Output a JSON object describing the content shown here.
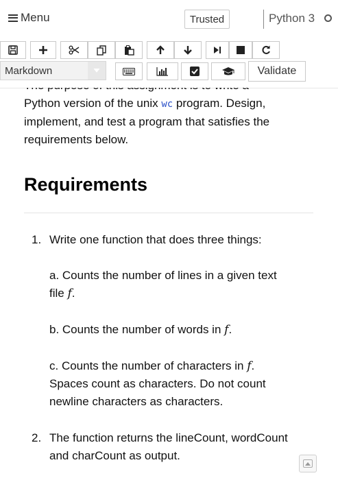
{
  "menubar": {
    "menu_label": "Menu",
    "trusted_label": "Trusted",
    "kernel_name": "Python 3"
  },
  "toolbar": {
    "buttons": [
      {
        "name": "save-button",
        "icon": "floppy-disk-icon"
      },
      {
        "name": "insert-cell-button",
        "icon": "plus-icon"
      },
      {
        "name": "cut-button",
        "icon": "scissors-icon"
      },
      {
        "name": "copy-button",
        "icon": "copy-icon"
      },
      {
        "name": "paste-button",
        "icon": "paste-icon"
      },
      {
        "name": "move-up-button",
        "icon": "arrow-up-icon"
      },
      {
        "name": "move-down-button",
        "icon": "arrow-down-icon"
      },
      {
        "name": "run-button",
        "icon": "step-forward-icon"
      },
      {
        "name": "stop-button",
        "icon": "stop-icon"
      },
      {
        "name": "restart-button",
        "icon": "refresh-icon"
      },
      {
        "name": "keyboard-button",
        "icon": "keyboard-icon"
      },
      {
        "name": "chart-button",
        "icon": "bar-chart-icon"
      },
      {
        "name": "checkbox-button",
        "icon": "check-square-icon"
      },
      {
        "name": "graduation-button",
        "icon": "graduation-cap-icon"
      }
    ],
    "cell_type": "Markdown",
    "validate_label": "Validate"
  },
  "notebook": {
    "intro_line1_cut": "The purpose of this assignment is to write a",
    "intro_line2_pre": "Python version of the unix ",
    "intro_code": "wc",
    "intro_line2_post": " program. Design,",
    "intro_line3": "implement, and test a program that satisfies the",
    "intro_line4": "requirements below.",
    "heading": "Requirements",
    "items": [
      {
        "number": "1.",
        "text": "Write one function that does three things:",
        "sub": {
          "a_line1": "a. Counts the number of lines in a given text",
          "a_line2": "file ",
          "a_var": "f",
          "a_end": ".",
          "b_text": "b. Counts the number of words in ",
          "b_var": "f",
          "b_end": ".",
          "c_text": "c. Counts the number of characters in ",
          "c_var": "f",
          "c_end": ".",
          "c_line2": "Spaces count as characters. Do not count",
          "c_line3": "newline characters as characters."
        }
      },
      {
        "number": "2.",
        "line1": "The function returns the lineCount, wordCount",
        "line2": "and charCount as output."
      }
    ]
  }
}
